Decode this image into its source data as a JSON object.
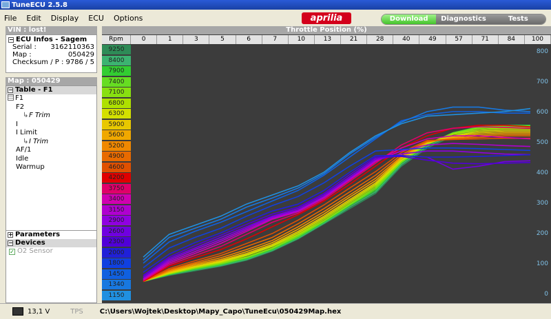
{
  "window": {
    "title": "TuneECU 2.5.8"
  },
  "menu": [
    "File",
    "Edit",
    "Display",
    "ECU",
    "Options"
  ],
  "brand": {
    "logo_text": "aprilia",
    "color": "#d3001b"
  },
  "tabs": [
    {
      "label": "Download",
      "active": true
    },
    {
      "label": "Diagnostics",
      "active": false
    },
    {
      "label": "Tests",
      "active": false
    }
  ],
  "vin": {
    "label": "VIN : lost!"
  },
  "ecu_infos": {
    "title": "ECU Infos -  Sagem",
    "serial_label": "Serial :",
    "serial": "3162110363",
    "map_label": "Map :",
    "map": "050429",
    "checksum_label": "Checksum / P :",
    "checksum": "9786 / 5"
  },
  "map_header": "Map : 050429",
  "tree": {
    "title": "Table - F1",
    "items": [
      {
        "label": "F1",
        "type": "table"
      },
      {
        "label": "F2",
        "type": "plain"
      },
      {
        "label": "F Trim",
        "type": "sub"
      },
      {
        "label": "I",
        "type": "plain"
      },
      {
        "label": "I Limit",
        "type": "plain"
      },
      {
        "label": "I Trim",
        "type": "sub"
      },
      {
        "label": "AF/1",
        "type": "plain"
      },
      {
        "label": "Idle",
        "type": "plain"
      },
      {
        "label": "Warmup",
        "type": "plain"
      }
    ]
  },
  "parameters": {
    "label": "Parameters"
  },
  "devices": {
    "label": "Devices",
    "sensor": "O2 Sensor"
  },
  "chart_data": {
    "type": "line",
    "title": "Throttle Position (%)",
    "xlabel": "Throttle Position (%)",
    "ylabel": "",
    "rpm_header": "Rpm",
    "x": [
      "0",
      "1",
      "3",
      "5",
      "6",
      "7",
      "10",
      "13",
      "21",
      "28",
      "40",
      "49",
      "57",
      "71",
      "84",
      "100"
    ],
    "ylim": [
      0,
      800
    ],
    "yticks": [
      0,
      100,
      200,
      300,
      400,
      500,
      600,
      700,
      800
    ],
    "series": [
      {
        "name": "9250",
        "color": "#2e8b57",
        "values": [
          40,
          60,
          75,
          90,
          110,
          140,
          180,
          230,
          280,
          330,
          420,
          480,
          520,
          540,
          545,
          545
        ]
      },
      {
        "name": "8400",
        "color": "#3cb371",
        "values": [
          40,
          62,
          78,
          92,
          112,
          142,
          182,
          232,
          285,
          335,
          425,
          485,
          525,
          545,
          550,
          550
        ]
      },
      {
        "name": "7900",
        "color": "#32cd32",
        "values": [
          40,
          63,
          80,
          95,
          115,
          145,
          185,
          235,
          290,
          340,
          430,
          490,
          530,
          550,
          555,
          555
        ]
      },
      {
        "name": "7400",
        "color": "#66dd22",
        "values": [
          40,
          64,
          82,
          97,
          118,
          148,
          188,
          238,
          292,
          345,
          432,
          492,
          530,
          548,
          552,
          552
        ]
      },
      {
        "name": "7100",
        "color": "#88e010",
        "values": [
          40,
          65,
          84,
          100,
          120,
          150,
          192,
          240,
          295,
          350,
          435,
          495,
          528,
          545,
          548,
          548
        ]
      },
      {
        "name": "6800",
        "color": "#aee000",
        "values": [
          40,
          66,
          86,
          102,
          125,
          155,
          195,
          245,
          300,
          355,
          438,
          495,
          525,
          540,
          545,
          545
        ]
      },
      {
        "name": "6300",
        "color": "#d4e000",
        "values": [
          40,
          68,
          88,
          105,
          128,
          158,
          200,
          250,
          305,
          360,
          440,
          495,
          520,
          535,
          540,
          540
        ]
      },
      {
        "name": "5900",
        "color": "#e8c800",
        "values": [
          40,
          70,
          90,
          108,
          132,
          162,
          205,
          255,
          310,
          365,
          445,
          498,
          518,
          530,
          535,
          535
        ]
      },
      {
        "name": "5600",
        "color": "#f0a800",
        "values": [
          40,
          72,
          94,
          112,
          138,
          168,
          212,
          262,
          318,
          372,
          448,
          500,
          515,
          525,
          530,
          530
        ]
      },
      {
        "name": "5200",
        "color": "#f08800",
        "values": [
          40,
          75,
          98,
          118,
          145,
          175,
          220,
          270,
          325,
          380,
          452,
          500,
          512,
          520,
          525,
          525
        ]
      },
      {
        "name": "4900",
        "color": "#e86a00",
        "values": [
          40,
          78,
          102,
          125,
          155,
          185,
          230,
          280,
          335,
          390,
          458,
          502,
          510,
          515,
          520,
          520
        ]
      },
      {
        "name": "4600",
        "color": "#e05000",
        "values": [
          40,
          82,
          108,
          132,
          165,
          198,
          242,
          292,
          348,
          402,
          465,
          505,
          508,
          510,
          512,
          512
        ]
      },
      {
        "name": "4200",
        "color": "#e00000",
        "values": [
          40,
          90,
          118,
          145,
          180,
          220,
          260,
          305,
          360,
          420,
          480,
          520,
          545,
          555,
          555,
          550
        ]
      },
      {
        "name": "3750",
        "color": "#e0006a",
        "values": [
          42,
          95,
          125,
          155,
          195,
          235,
          265,
          310,
          370,
          430,
          490,
          530,
          545,
          550,
          548,
          545
        ]
      },
      {
        "name": "3400",
        "color": "#d000b0",
        "values": [
          45,
          100,
          132,
          165,
          205,
          245,
          270,
          315,
          375,
          435,
          480,
          510,
          520,
          520,
          515,
          510
        ]
      },
      {
        "name": "3150",
        "color": "#b000d0",
        "values": [
          48,
          105,
          138,
          172,
          210,
          248,
          272,
          318,
          378,
          438,
          470,
          490,
          495,
          492,
          488,
          485
        ]
      },
      {
        "name": "2900",
        "color": "#9000e0",
        "values": [
          50,
          110,
          145,
          178,
          215,
          252,
          275,
          320,
          380,
          440,
          460,
          470,
          470,
          465,
          460,
          458
        ]
      },
      {
        "name": "2600",
        "color": "#7000e0",
        "values": [
          55,
          115,
          150,
          185,
          220,
          255,
          280,
          325,
          385,
          445,
          455,
          450,
          410,
          420,
          435,
          438
        ]
      },
      {
        "name": "2300",
        "color": "#5000d8",
        "values": [
          60,
          120,
          158,
          192,
          228,
          262,
          285,
          330,
          392,
          450,
          452,
          440,
          430,
          428,
          430,
          432
        ]
      },
      {
        "name": "2000",
        "color": "#2020d8",
        "values": [
          70,
          130,
          168,
          200,
          238,
          272,
          295,
          340,
          400,
          455,
          455,
          450,
          450,
          452,
          455,
          458
        ]
      },
      {
        "name": "1800",
        "color": "#1040e0",
        "values": [
          85,
          150,
          185,
          215,
          255,
          290,
          320,
          365,
          420,
          470,
          475,
          480,
          480,
          478,
          475,
          472
        ]
      },
      {
        "name": "1450",
        "color": "#1060e0",
        "values": [
          100,
          170,
          205,
          235,
          270,
          305,
          340,
          390,
          450,
          510,
          570,
          590,
          600,
          600,
          595,
          595
        ]
      },
      {
        "name": "1340",
        "color": "#1878e0",
        "values": [
          110,
          185,
          215,
          245,
          285,
          315,
          348,
          395,
          460,
          515,
          565,
          600,
          615,
          615,
          605,
          600
        ]
      },
      {
        "name": "1150",
        "color": "#2090e0",
        "values": [
          120,
          195,
          225,
          255,
          295,
          325,
          355,
          400,
          465,
          520,
          560,
          585,
          590,
          595,
          600,
          610
        ]
      }
    ]
  },
  "status": {
    "voltage": "13,1 V",
    "tps": "TPS",
    "path": "C:\\Users\\Wojtek\\Desktop\\Mapy_Capo\\TuneEcu\\050429Map.hex"
  }
}
